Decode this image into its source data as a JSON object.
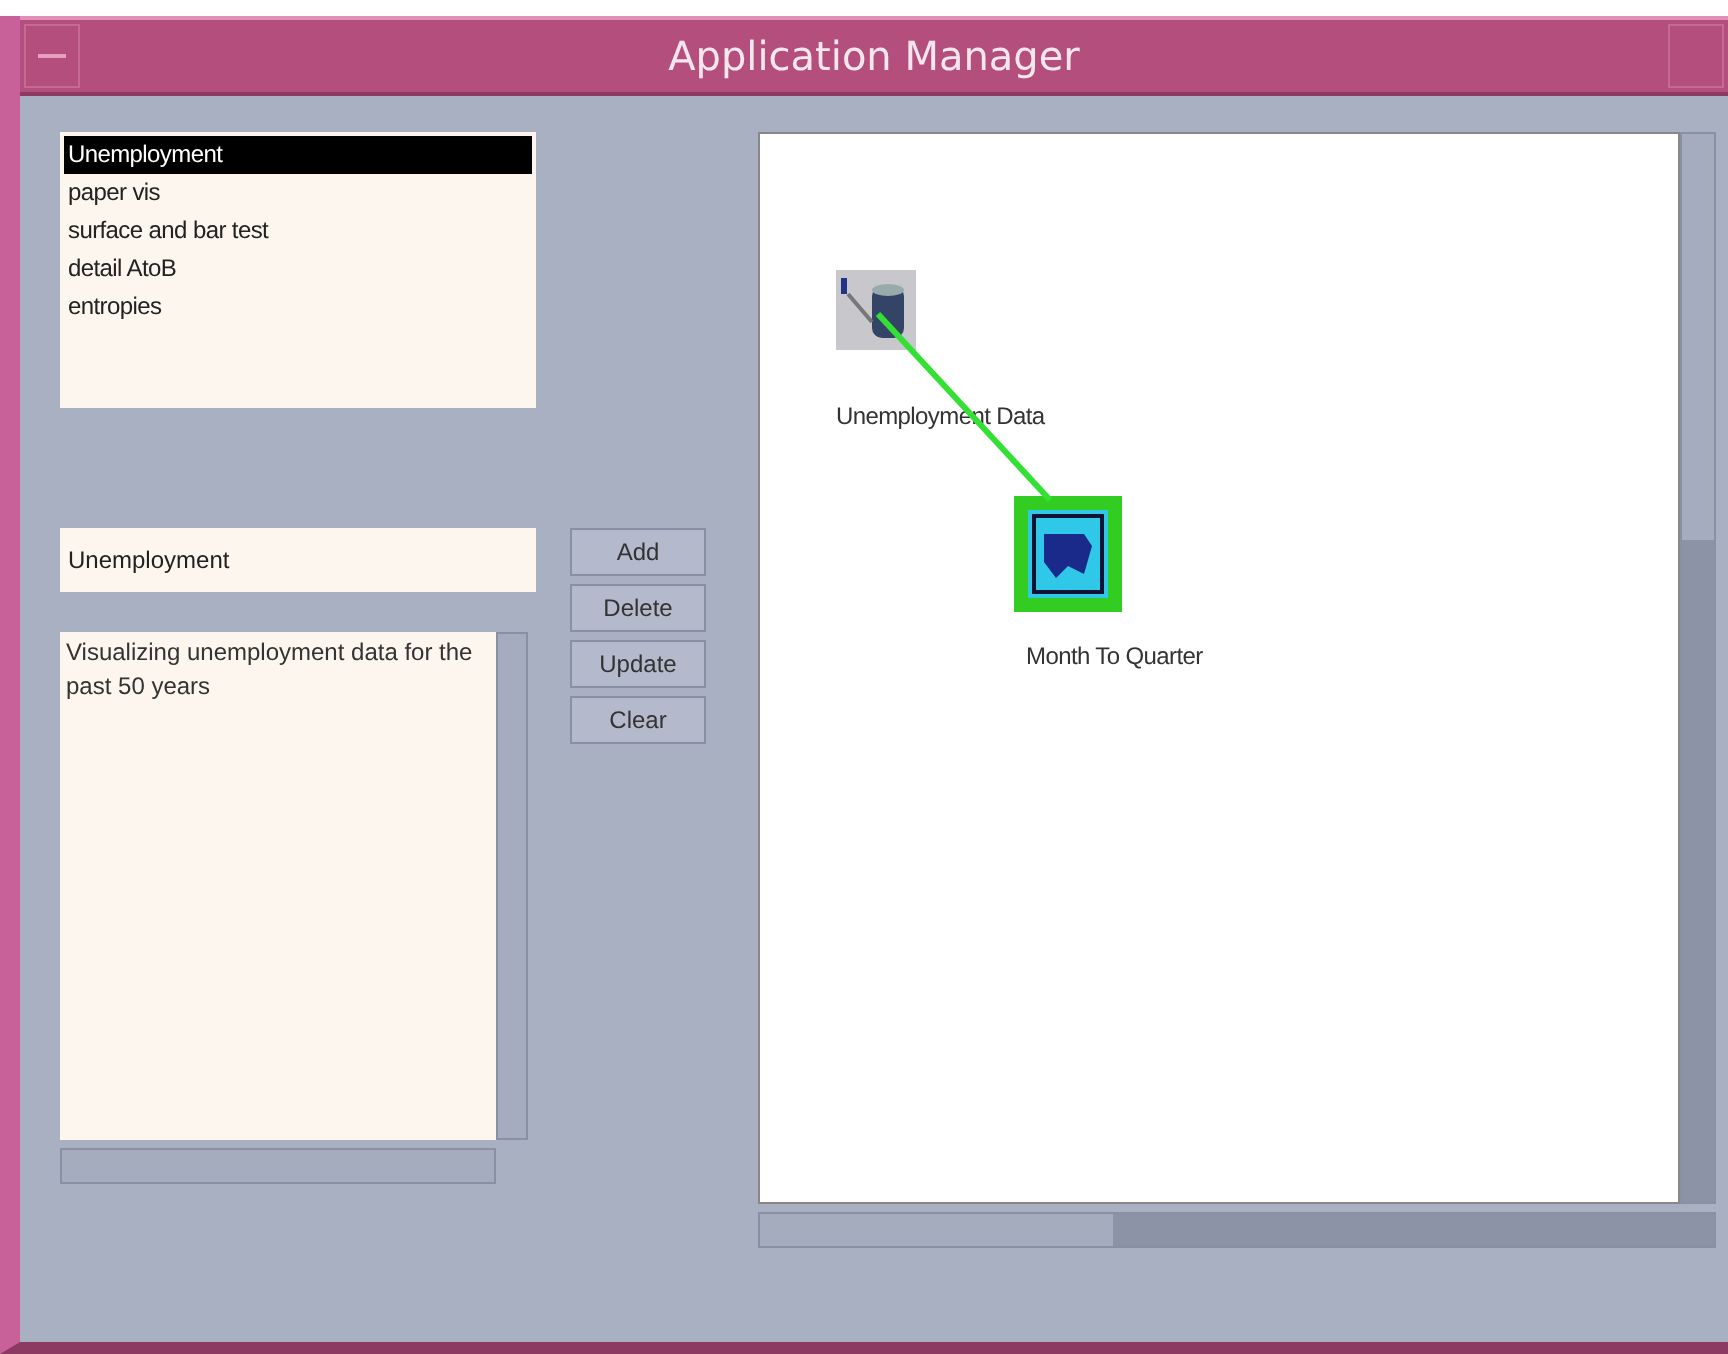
{
  "window": {
    "title": "Application Manager"
  },
  "projects": [
    {
      "label": "Unemployment",
      "selected": true
    },
    {
      "label": "paper vis",
      "selected": false
    },
    {
      "label": "surface and bar test",
      "selected": false
    },
    {
      "label": "detail AtoB",
      "selected": false
    },
    {
      "label": "entropies",
      "selected": false
    }
  ],
  "name_field": {
    "value": "Unemployment"
  },
  "description": {
    "value": "Visualizing unemployment data for the past 50 years"
  },
  "buttons": [
    "Add",
    "Delete",
    "Update",
    "Clear"
  ],
  "canvas": {
    "nodes": [
      {
        "label": "Unemployment Data",
        "kind": "data",
        "selected": false
      },
      {
        "label": "Month To Quarter",
        "kind": "transform",
        "selected": true
      }
    ]
  }
}
